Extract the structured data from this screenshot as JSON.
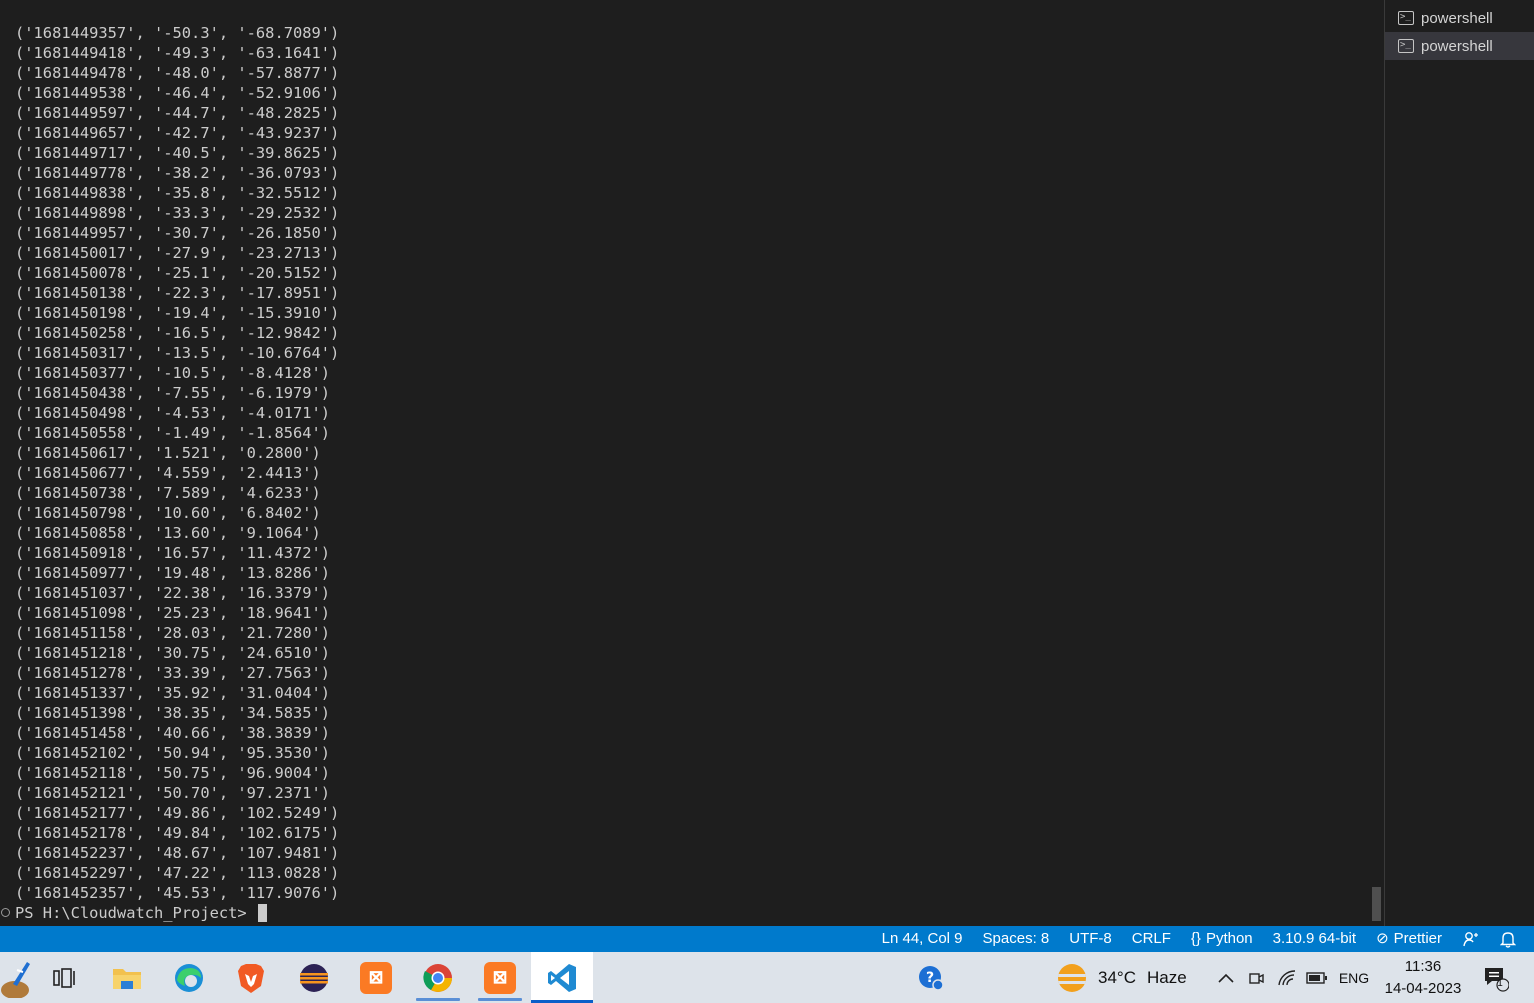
{
  "terminal": {
    "lines": [
      "('1681449357', '-50.3', '-68.7089')",
      "('1681449418', '-49.3', '-63.1641')",
      "('1681449478', '-48.0', '-57.8877')",
      "('1681449538', '-46.4', '-52.9106')",
      "('1681449597', '-44.7', '-48.2825')",
      "('1681449657', '-42.7', '-43.9237')",
      "('1681449717', '-40.5', '-39.8625')",
      "('1681449778', '-38.2', '-36.0793')",
      "('1681449838', '-35.8', '-32.5512')",
      "('1681449898', '-33.3', '-29.2532')",
      "('1681449957', '-30.7', '-26.1850')",
      "('1681450017', '-27.9', '-23.2713')",
      "('1681450078', '-25.1', '-20.5152')",
      "('1681450138', '-22.3', '-17.8951')",
      "('1681450198', '-19.4', '-15.3910')",
      "('1681450258', '-16.5', '-12.9842')",
      "('1681450317', '-13.5', '-10.6764')",
      "('1681450377', '-10.5', '-8.4128')",
      "('1681450438', '-7.55', '-6.1979')",
      "('1681450498', '-4.53', '-4.0171')",
      "('1681450558', '-1.49', '-1.8564')",
      "('1681450617', '1.521', '0.2800')",
      "('1681450677', '4.559', '2.4413')",
      "('1681450738', '7.589', '4.6233')",
      "('1681450798', '10.60', '6.8402')",
      "('1681450858', '13.60', '9.1064')",
      "('1681450918', '16.57', '11.4372')",
      "('1681450977', '19.48', '13.8286')",
      "('1681451037', '22.38', '16.3379')",
      "('1681451098', '25.23', '18.9641')",
      "('1681451158', '28.03', '21.7280')",
      "('1681451218', '30.75', '24.6510')",
      "('1681451278', '33.39', '27.7563')",
      "('1681451337', '35.92', '31.0404')",
      "('1681451398', '38.35', '34.5835')",
      "('1681451458', '40.66', '38.3839')",
      "('1681452102', '50.94', '95.3530')",
      "('1681452118', '50.75', '96.9004')",
      "('1681452121', '50.70', '97.2371')",
      "('1681452177', '49.86', '102.5249')",
      "('1681452178', '49.84', '102.6175')",
      "('1681452237', '48.67', '107.9481')",
      "('1681452297', '47.22', '113.0828')",
      "('1681452357', '45.53', '117.9076')"
    ],
    "prompt": "PS H:\\Cloudwatch_Project> "
  },
  "terminal_tabs": [
    {
      "label": "powershell",
      "icon": "terminal-icon",
      "active": false
    },
    {
      "label": "powershell",
      "icon": "terminal-icon",
      "active": true
    }
  ],
  "statusbar": {
    "cursor_position": "Ln 44, Col 9",
    "spaces": "Spaces: 8",
    "encoding": "UTF-8",
    "line_ending": "CRLF",
    "language": "Python",
    "interpreter": "3.10.9 64-bit",
    "formatter": "Prettier",
    "accent_color": "#007acc"
  },
  "taskbar": {
    "apps": [
      {
        "name": "paint-app",
        "active": false,
        "running": false
      },
      {
        "name": "task-view",
        "active": false,
        "running": false
      },
      {
        "name": "file-explorer",
        "active": false,
        "running": false
      },
      {
        "name": "edge-browser",
        "active": false,
        "running": false
      },
      {
        "name": "brave-browser",
        "active": false,
        "running": false
      },
      {
        "name": "eclipse-ide",
        "active": false,
        "running": false
      },
      {
        "name": "xampp-control",
        "active": false,
        "running": false
      },
      {
        "name": "chrome-browser",
        "active": false,
        "running": true
      },
      {
        "name": "xampp-control-2",
        "active": false,
        "running": true
      },
      {
        "name": "vscode",
        "active": true,
        "running": true
      }
    ],
    "weather": {
      "temperature": "34°C",
      "condition": "Haze"
    },
    "language": "ENG",
    "time": "11:36",
    "date": "14-04-2023",
    "notification_count": "1"
  }
}
